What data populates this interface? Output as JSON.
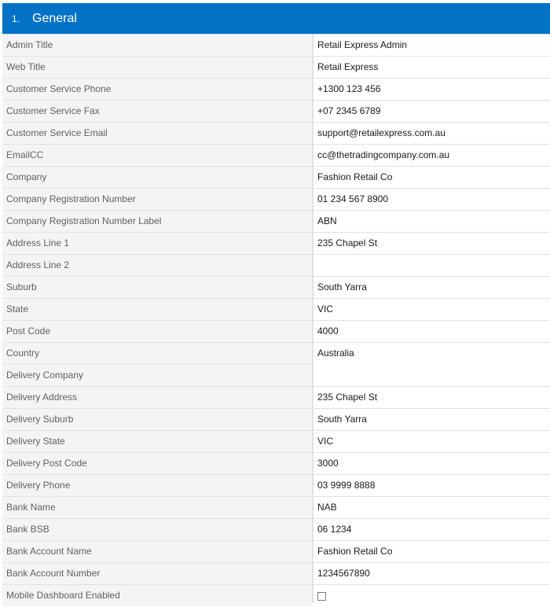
{
  "section": {
    "number": "1.",
    "title": "General"
  },
  "fields": [
    {
      "key": "admin-title",
      "label": "Admin Title",
      "value": "Retail Express Admin"
    },
    {
      "key": "web-title",
      "label": "Web Title",
      "value": "Retail Express"
    },
    {
      "key": "customer-service-phone",
      "label": "Customer Service Phone",
      "value": "+1300 123 456"
    },
    {
      "key": "customer-service-fax",
      "label": "Customer Service Fax",
      "value": "+07 2345 6789"
    },
    {
      "key": "customer-service-email",
      "label": "Customer Service Email",
      "value": "support@retailexpress.com.au"
    },
    {
      "key": "emailcc",
      "label": "EmailCC",
      "value": "cc@thetradingcompany.com.au"
    },
    {
      "key": "company",
      "label": "Company",
      "value": "Fashion Retail Co"
    },
    {
      "key": "company-registration-number",
      "label": "Company Registration Number",
      "value": "01 234 567 8900"
    },
    {
      "key": "company-registration-number-label",
      "label": "Company Registration Number Label",
      "value": "ABN"
    },
    {
      "key": "address-line-1",
      "label": "Address Line 1",
      "value": "235 Chapel St"
    },
    {
      "key": "address-line-2",
      "label": "Address Line 2",
      "value": ""
    },
    {
      "key": "suburb",
      "label": "Suburb",
      "value": "South Yarra"
    },
    {
      "key": "state",
      "label": "State",
      "value": "VIC"
    },
    {
      "key": "post-code",
      "label": "Post Code",
      "value": "4000"
    },
    {
      "key": "country",
      "label": "Country",
      "value": "Australia"
    },
    {
      "key": "delivery-company",
      "label": "Delivery Company",
      "value": ""
    },
    {
      "key": "delivery-address",
      "label": "Delivery Address",
      "value": "235 Chapel St"
    },
    {
      "key": "delivery-suburb",
      "label": "Delivery Suburb",
      "value": "South Yarra"
    },
    {
      "key": "delivery-state",
      "label": "Delivery State",
      "value": "VIC"
    },
    {
      "key": "delivery-post-code",
      "label": "Delivery Post Code",
      "value": "3000"
    },
    {
      "key": "delivery-phone",
      "label": "Delivery Phone",
      "value": "03 9999 8888"
    },
    {
      "key": "bank-name",
      "label": "Bank Name",
      "value": "NAB"
    },
    {
      "key": "bank-bsb",
      "label": "Bank BSB",
      "value": "06 1234"
    },
    {
      "key": "bank-account-name",
      "label": "Bank Account Name",
      "value": "Fashion Retail Co"
    },
    {
      "key": "bank-account-number",
      "label": "Bank Account Number",
      "value": "1234567890"
    },
    {
      "key": "mobile-dashboard-enabled",
      "label": "Mobile Dashboard Enabled",
      "checkbox": true,
      "checked": false
    }
  ],
  "colors": {
    "header": "#0473c7",
    "label_bg": "#f4f4f4",
    "border": "#e2e2e2"
  }
}
